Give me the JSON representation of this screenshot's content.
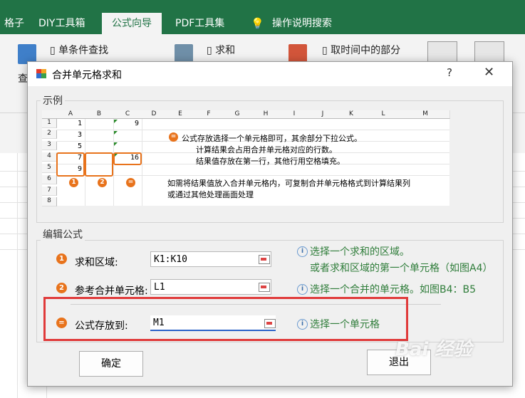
{
  "ribbon": {
    "tabs": [
      {
        "label": "格子"
      },
      {
        "label": "DIY工具箱"
      },
      {
        "label": "公式向导"
      },
      {
        "label": "PDF工具集"
      },
      {
        "label": "操作说明搜索"
      }
    ],
    "buttons": {
      "single_lookup": "单条件查找",
      "sum": "求和",
      "middle_part": "取时间中的部分",
      "left_partial": "查"
    }
  },
  "dialog": {
    "title": "合并单元格求和",
    "help": "?",
    "close": "✕",
    "example_group": "示例",
    "edit_group": "编辑公式",
    "example": {
      "columns": [
        "A",
        "B",
        "C",
        "D",
        "E",
        "F",
        "G",
        "H",
        "I",
        "J",
        "K",
        "L",
        "M"
      ],
      "rows": [
        "1",
        "2",
        "3",
        "4",
        "5",
        "6",
        "7",
        "8"
      ],
      "col_a": [
        "1",
        "3",
        "5",
        "7",
        "9"
      ],
      "col_c": [
        "9",
        "16"
      ],
      "notes": [
        "公式存放选择一个单元格即可，其余部分下拉公式。",
        "计算结果会占用合并单元格对应的行数。",
        "结果值存放在第一行，其他行用空格填充。",
        "如需将结果值放入合并单元格内，可复制合并单元格格式到计算结果列",
        "或通过其他处理画面处理"
      ],
      "markers": [
        "1",
        "2",
        "="
      ]
    },
    "fields": [
      {
        "num": "1",
        "label": "求和区域:",
        "value": "K1:K10",
        "hint1": "选择一个求和的区域。",
        "hint2": "或者求和区域的第一个单元格（如图A4）"
      },
      {
        "num": "2",
        "label": "参考合并单元格:",
        "value": "L1",
        "hint1": "选择一个合并的单元格。如图B4：B5"
      },
      {
        "num": "=",
        "label": "公式存放到:",
        "value": "M1",
        "hint1": "选择一个单元格"
      }
    ],
    "buttons": {
      "ok": "确定",
      "exit": "退出"
    }
  },
  "watermark": "Bai 经验",
  "colors": {
    "excel_green": "#217346",
    "accent_orange": "#e8731c",
    "hint_green": "#2f7d3a",
    "highlight_red": "#e03a3a"
  }
}
